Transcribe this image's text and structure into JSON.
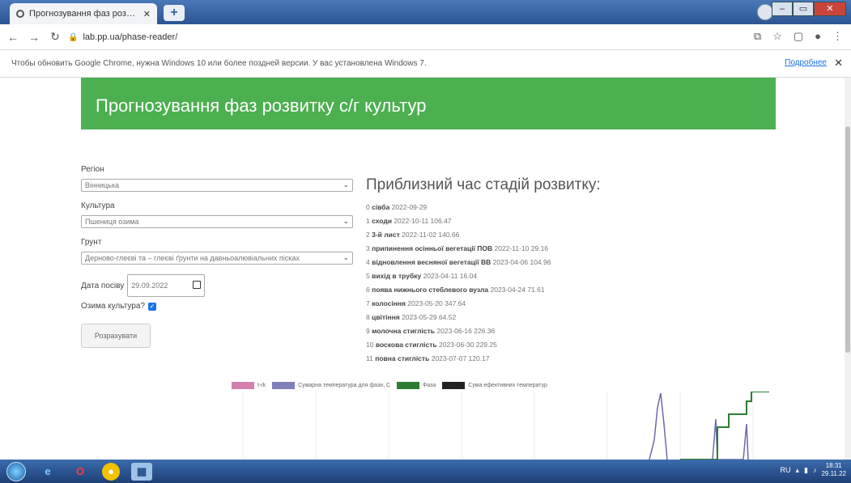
{
  "browser": {
    "tab_title": "Прогнозування фаз розвитку с",
    "new_tab_label": "+",
    "url": "lab.pp.ua/phase-reader/",
    "infobar_text": "Чтобы обновить Google Chrome, нужна Windows 10 или более поздней версии. У вас установлена Windows 7.",
    "infobar_link": "Подробнее"
  },
  "page": {
    "title": "Прогнозування фаз розвитку с/г культур",
    "form": {
      "region_label": "Регіон",
      "region_value": "Вінницька",
      "crop_label": "Культура",
      "crop_value": "Пшениця озима",
      "soil_label": "Грунт",
      "soil_value": "Дерново-глеєві та – глеєві ґрунти на давньоалювіальних пісках",
      "sow_date_label": "Дата посіву",
      "sow_date_value": "29.09.2022",
      "winter_crop_label": "Озима культура?",
      "calc_button": "Розрахувати"
    },
    "results": {
      "heading": "Приблизний час стадій розвитку:",
      "stages": [
        {
          "num": "0",
          "name": "сівба",
          "value": "2022-09-29"
        },
        {
          "num": "1",
          "name": "сходи",
          "value": "2022-10-11 106.47"
        },
        {
          "num": "2",
          "name": "3-й лист",
          "value": "2022-11-02 140.66"
        },
        {
          "num": "3",
          "name": "припинення осінньої вегетації ПОВ",
          "value": "2022-11-10 29.16"
        },
        {
          "num": "4",
          "name": "відновлення весняної вегетації ВВ",
          "value": "2023-04-06 104.96"
        },
        {
          "num": "5",
          "name": "вихід в трубку",
          "value": "2023-04-11 16.04"
        },
        {
          "num": "6",
          "name": "поява нижнього стеблевого вузла",
          "value": "2023-04-24 71.61"
        },
        {
          "num": "7",
          "name": "колосіння",
          "value": "2023-05-20 347.64"
        },
        {
          "num": "8",
          "name": "цвітіння",
          "value": "2023-05-29 64.52"
        },
        {
          "num": "9",
          "name": "молочна стиглість",
          "value": "2023-06-16 226.36"
        },
        {
          "num": "10",
          "name": "воскова стиглість",
          "value": "2023-06-30 229.25"
        },
        {
          "num": "11",
          "name": "повна стиглість",
          "value": "2023-07-07 120.17"
        }
      ]
    },
    "legend": [
      {
        "label": "t-rk",
        "color": "#d47fb0"
      },
      {
        "label": "Сумарна температура для фази, С",
        "color": "#8080b8"
      },
      {
        "label": "Фаза",
        "color": "#2e7d32"
      },
      {
        "label": "Сума ефективних температур",
        "color": "#222222"
      }
    ]
  },
  "taskbar": {
    "lang": "RU",
    "time": "18:31",
    "date": "29.11.22"
  }
}
